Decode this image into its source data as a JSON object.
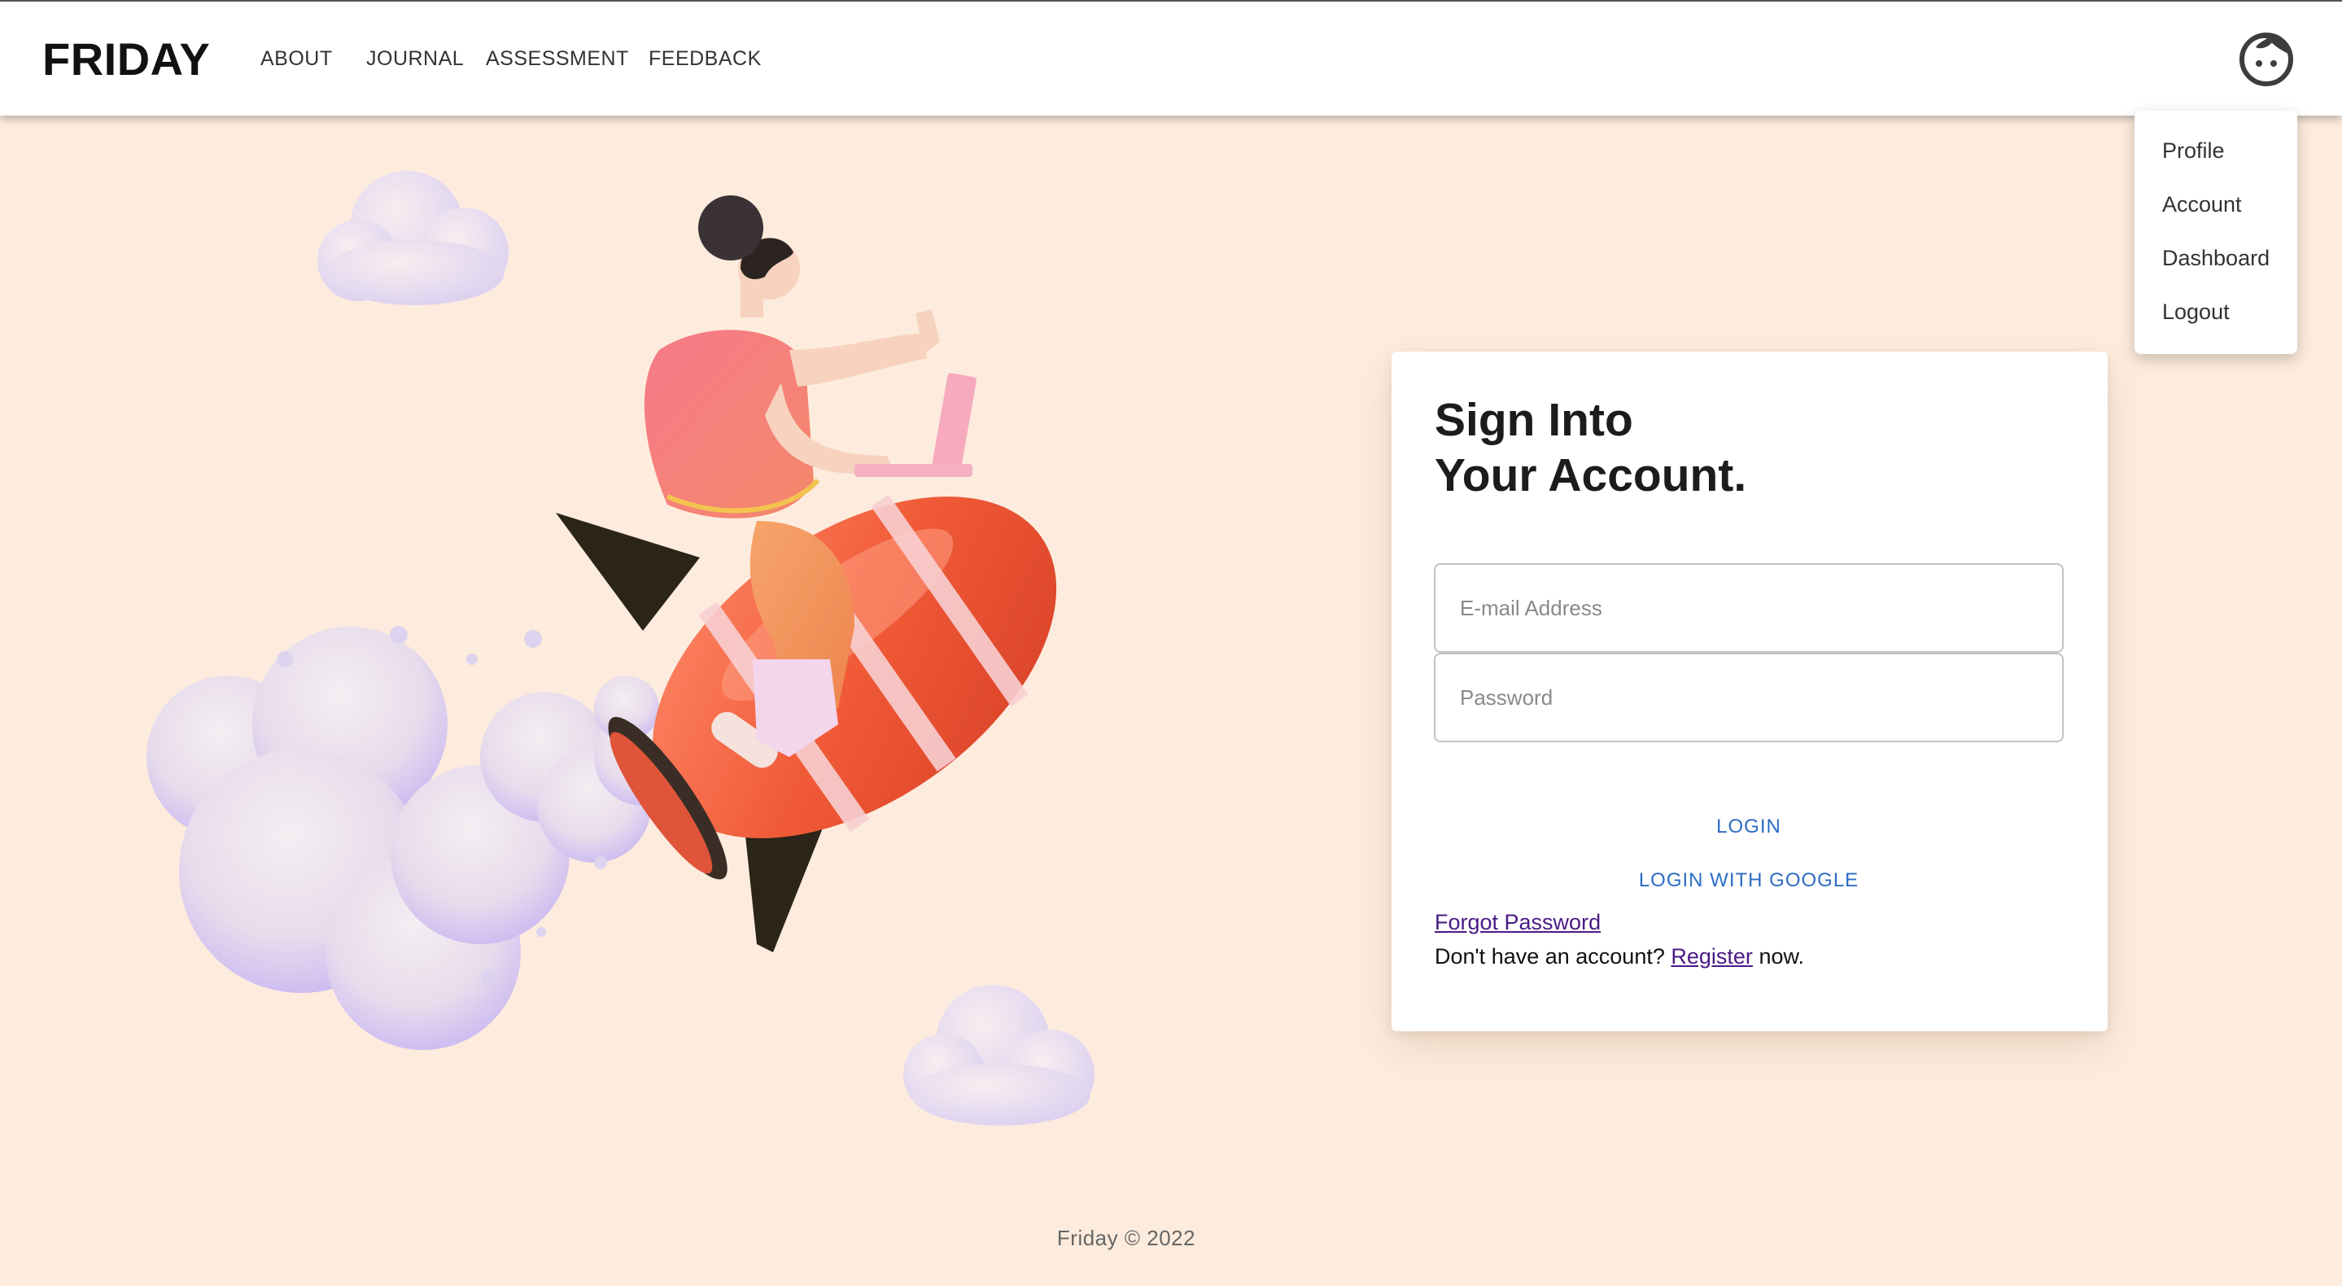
{
  "header": {
    "brand": "FRIDAY",
    "nav": [
      "ABOUT",
      "JOURNAL",
      "ASSESSMENT",
      "FEEDBACK"
    ],
    "avatar_icon": "face-avatar-icon"
  },
  "user_menu": {
    "items": [
      "Profile",
      "Account",
      "Dashboard",
      "Logout"
    ]
  },
  "login": {
    "title_line1": "Sign Into",
    "title_line2": "Your Account.",
    "email_placeholder": "E-mail Address",
    "password_placeholder": "Password",
    "login_label": "LOGIN",
    "google_label": "LOGIN WITH GOOGLE",
    "forgot_label": "Forgot Password",
    "register_prefix": "Don't have an account?",
    "register_link": "Register",
    "register_suffix": "now."
  },
  "footer": {
    "text": "Friday © 2022"
  },
  "colors": {
    "background": "#fdecdd",
    "accent": "#2b6cc4",
    "link": "#4b1a86",
    "rocket": "#ef5a3a"
  }
}
